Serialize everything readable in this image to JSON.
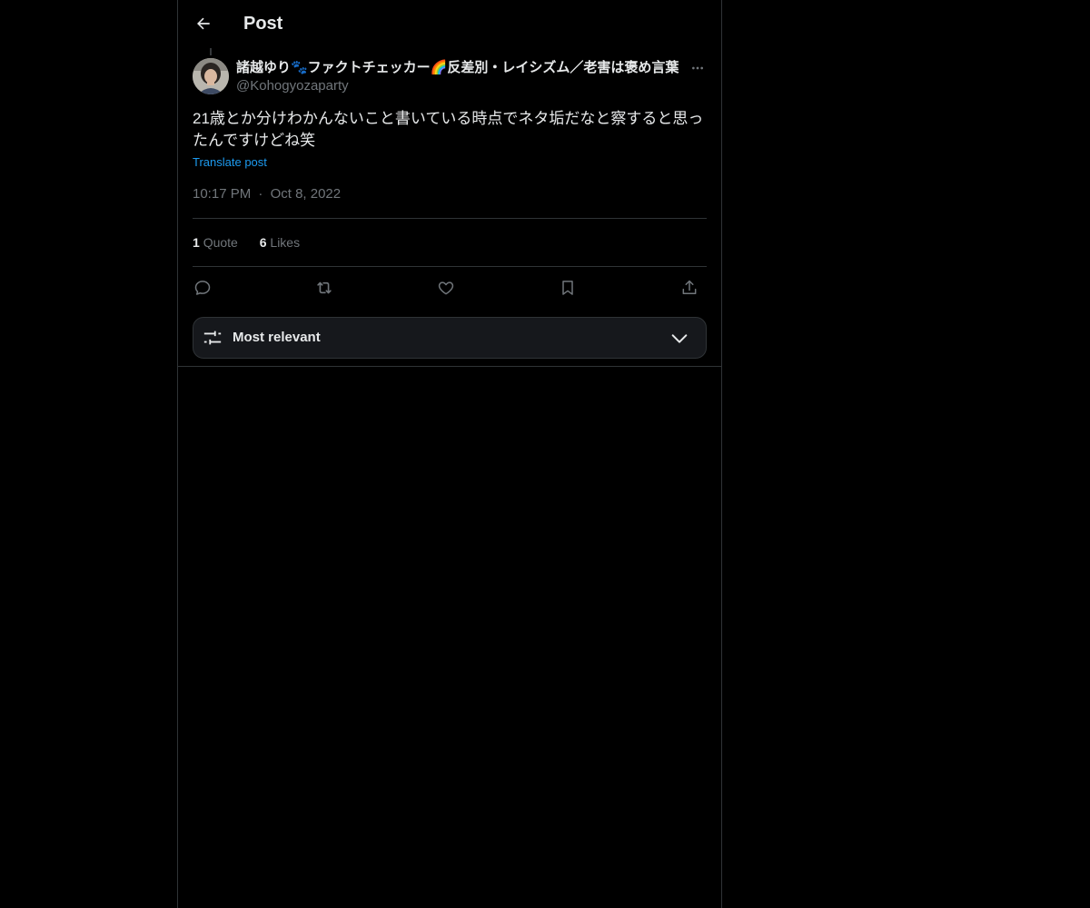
{
  "header": {
    "title": "Post",
    "back_icon": "arrow-left-icon"
  },
  "post": {
    "author_name": "諸越ゆり🐾ファクトチェッカー🌈反差別・レイシズム／老害は褒め言葉",
    "author_handle": "@Kohogyozaparty",
    "text": "21歳とか分けわかんないこと書いている時点でネタ垢だなと察すると思ったんですけどね笑",
    "translate_label": "Translate post",
    "time": "10:17 PM",
    "separator": "·",
    "date": "Oct 8, 2022"
  },
  "stats": {
    "quotes_count": "1",
    "quotes_label": "Quote",
    "likes_count": "6",
    "likes_label": "Likes"
  },
  "actions": {
    "icons": [
      "reply-icon",
      "repost-icon",
      "like-icon",
      "bookmark-icon",
      "share-icon"
    ]
  },
  "sort": {
    "label": "Most relevant",
    "icon": "sliders-icon",
    "chevron": "chevron-down-icon"
  },
  "colors": {
    "background": "#000000",
    "text_primary": "#e7e9ea",
    "text_secondary": "#71767b",
    "accent": "#1d9bf0",
    "border": "#2f3336"
  }
}
